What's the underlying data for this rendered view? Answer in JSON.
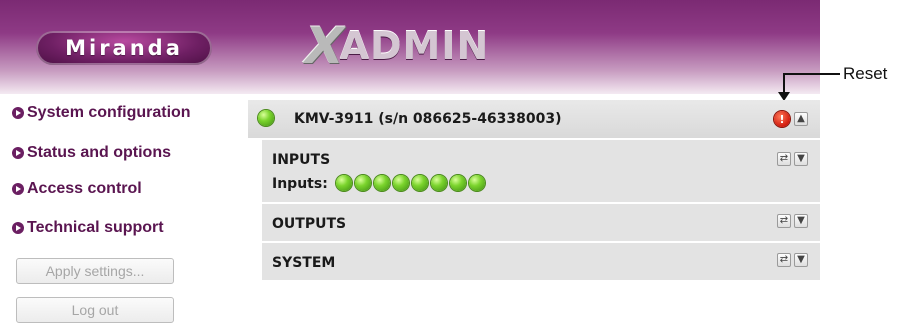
{
  "header": {
    "brand_logo": "Miranda",
    "product_x": "X",
    "product_rest": "ADMIN",
    "colors": {
      "primary": "#7b2a73",
      "nav_text": "#5a1550"
    }
  },
  "callout": {
    "label": "Reset"
  },
  "sidebar": {
    "items": [
      {
        "label": "System configuration"
      },
      {
        "label": "Status and options"
      },
      {
        "label": "Access control"
      },
      {
        "label": "Technical support"
      }
    ],
    "apply_button": "Apply settings...",
    "logout_button": "Log out"
  },
  "device": {
    "title": "KMV-3911 (s/n 086625-46338003)",
    "status": "ok",
    "reset_icon": "!",
    "collapse_icon": "▲"
  },
  "sections": [
    {
      "title": "INPUTS",
      "refresh_icon": "⇄",
      "expand_icon": "▼"
    },
    {
      "title": "OUTPUTS",
      "refresh_icon": "⇄",
      "expand_icon": "▼"
    },
    {
      "title": "SYSTEM",
      "refresh_icon": "⇄",
      "expand_icon": "▼"
    }
  ],
  "inputs": {
    "label": "Inputs:",
    "count": 8,
    "status": "ok"
  }
}
